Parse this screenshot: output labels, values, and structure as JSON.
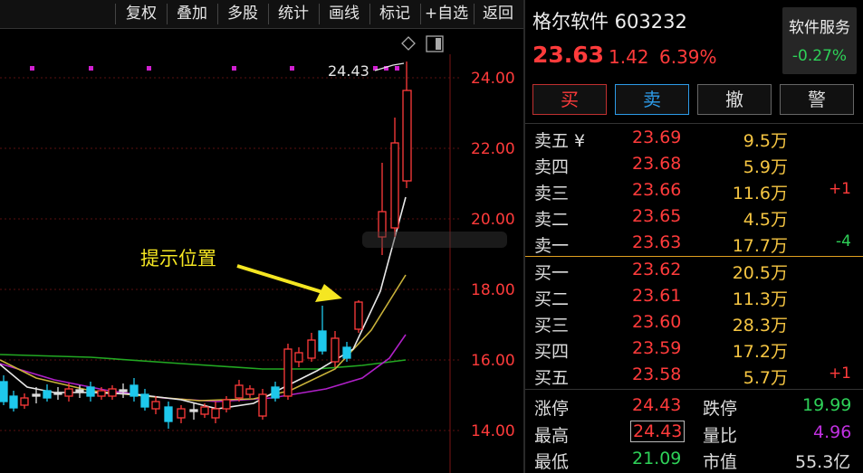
{
  "toolbar": {
    "items": [
      "复权",
      "叠加",
      "多股",
      "统计",
      "画线",
      "标记",
      "+自选",
      "返回"
    ]
  },
  "chart": {
    "price_axis": [
      "24.00",
      "22.00",
      "20.00",
      "18.00",
      "16.00",
      "14.00"
    ],
    "high_marker": "24.43",
    "annotation": "提示位置"
  },
  "quote": {
    "name_code": "格尔软件 603232",
    "price": "23.63",
    "change": "1.42",
    "change_pct": "6.39%",
    "sector_name": "软件服务",
    "sector_pct": "-0.27%"
  },
  "actions": {
    "buy": "买",
    "sell": "卖",
    "cancel": "撤",
    "alert": "警"
  },
  "asks": [
    {
      "label": "卖五 ¥",
      "price": "23.69",
      "vol": "9.5万",
      "delta": ""
    },
    {
      "label": "卖四",
      "price": "23.68",
      "vol": "5.9万",
      "delta": ""
    },
    {
      "label": "卖三",
      "price": "23.66",
      "vol": "11.6万",
      "delta": "+1"
    },
    {
      "label": "卖二",
      "price": "23.65",
      "vol": "4.5万",
      "delta": ""
    },
    {
      "label": "卖一",
      "price": "23.63",
      "vol": "17.7万",
      "delta": "-4"
    }
  ],
  "bids": [
    {
      "label": "买一",
      "price": "23.62",
      "vol": "20.5万",
      "delta": ""
    },
    {
      "label": "买二",
      "price": "23.61",
      "vol": "11.3万",
      "delta": ""
    },
    {
      "label": "买三",
      "price": "23.60",
      "vol": "28.3万",
      "delta": ""
    },
    {
      "label": "买四",
      "price": "23.59",
      "vol": "17.2万",
      "delta": ""
    },
    {
      "label": "买五",
      "price": "23.58",
      "vol": "5.7万",
      "delta": "+1"
    }
  ],
  "stats": {
    "limit_up_label": "涨停",
    "limit_up": "24.43",
    "limit_down_label": "跌停",
    "limit_down": "19.99",
    "high_label": "最高",
    "high": "24.43",
    "vol_ratio_label": "量比",
    "vol_ratio": "4.96",
    "low_label": "最低",
    "low": "21.09",
    "mkt_cap_label": "市值",
    "mkt_cap": "55.3亿"
  },
  "colors": {
    "up": "#ff3b3b",
    "down": "#2ed158",
    "flat": "#1ec8ec",
    "volume": "#f5c542"
  }
}
